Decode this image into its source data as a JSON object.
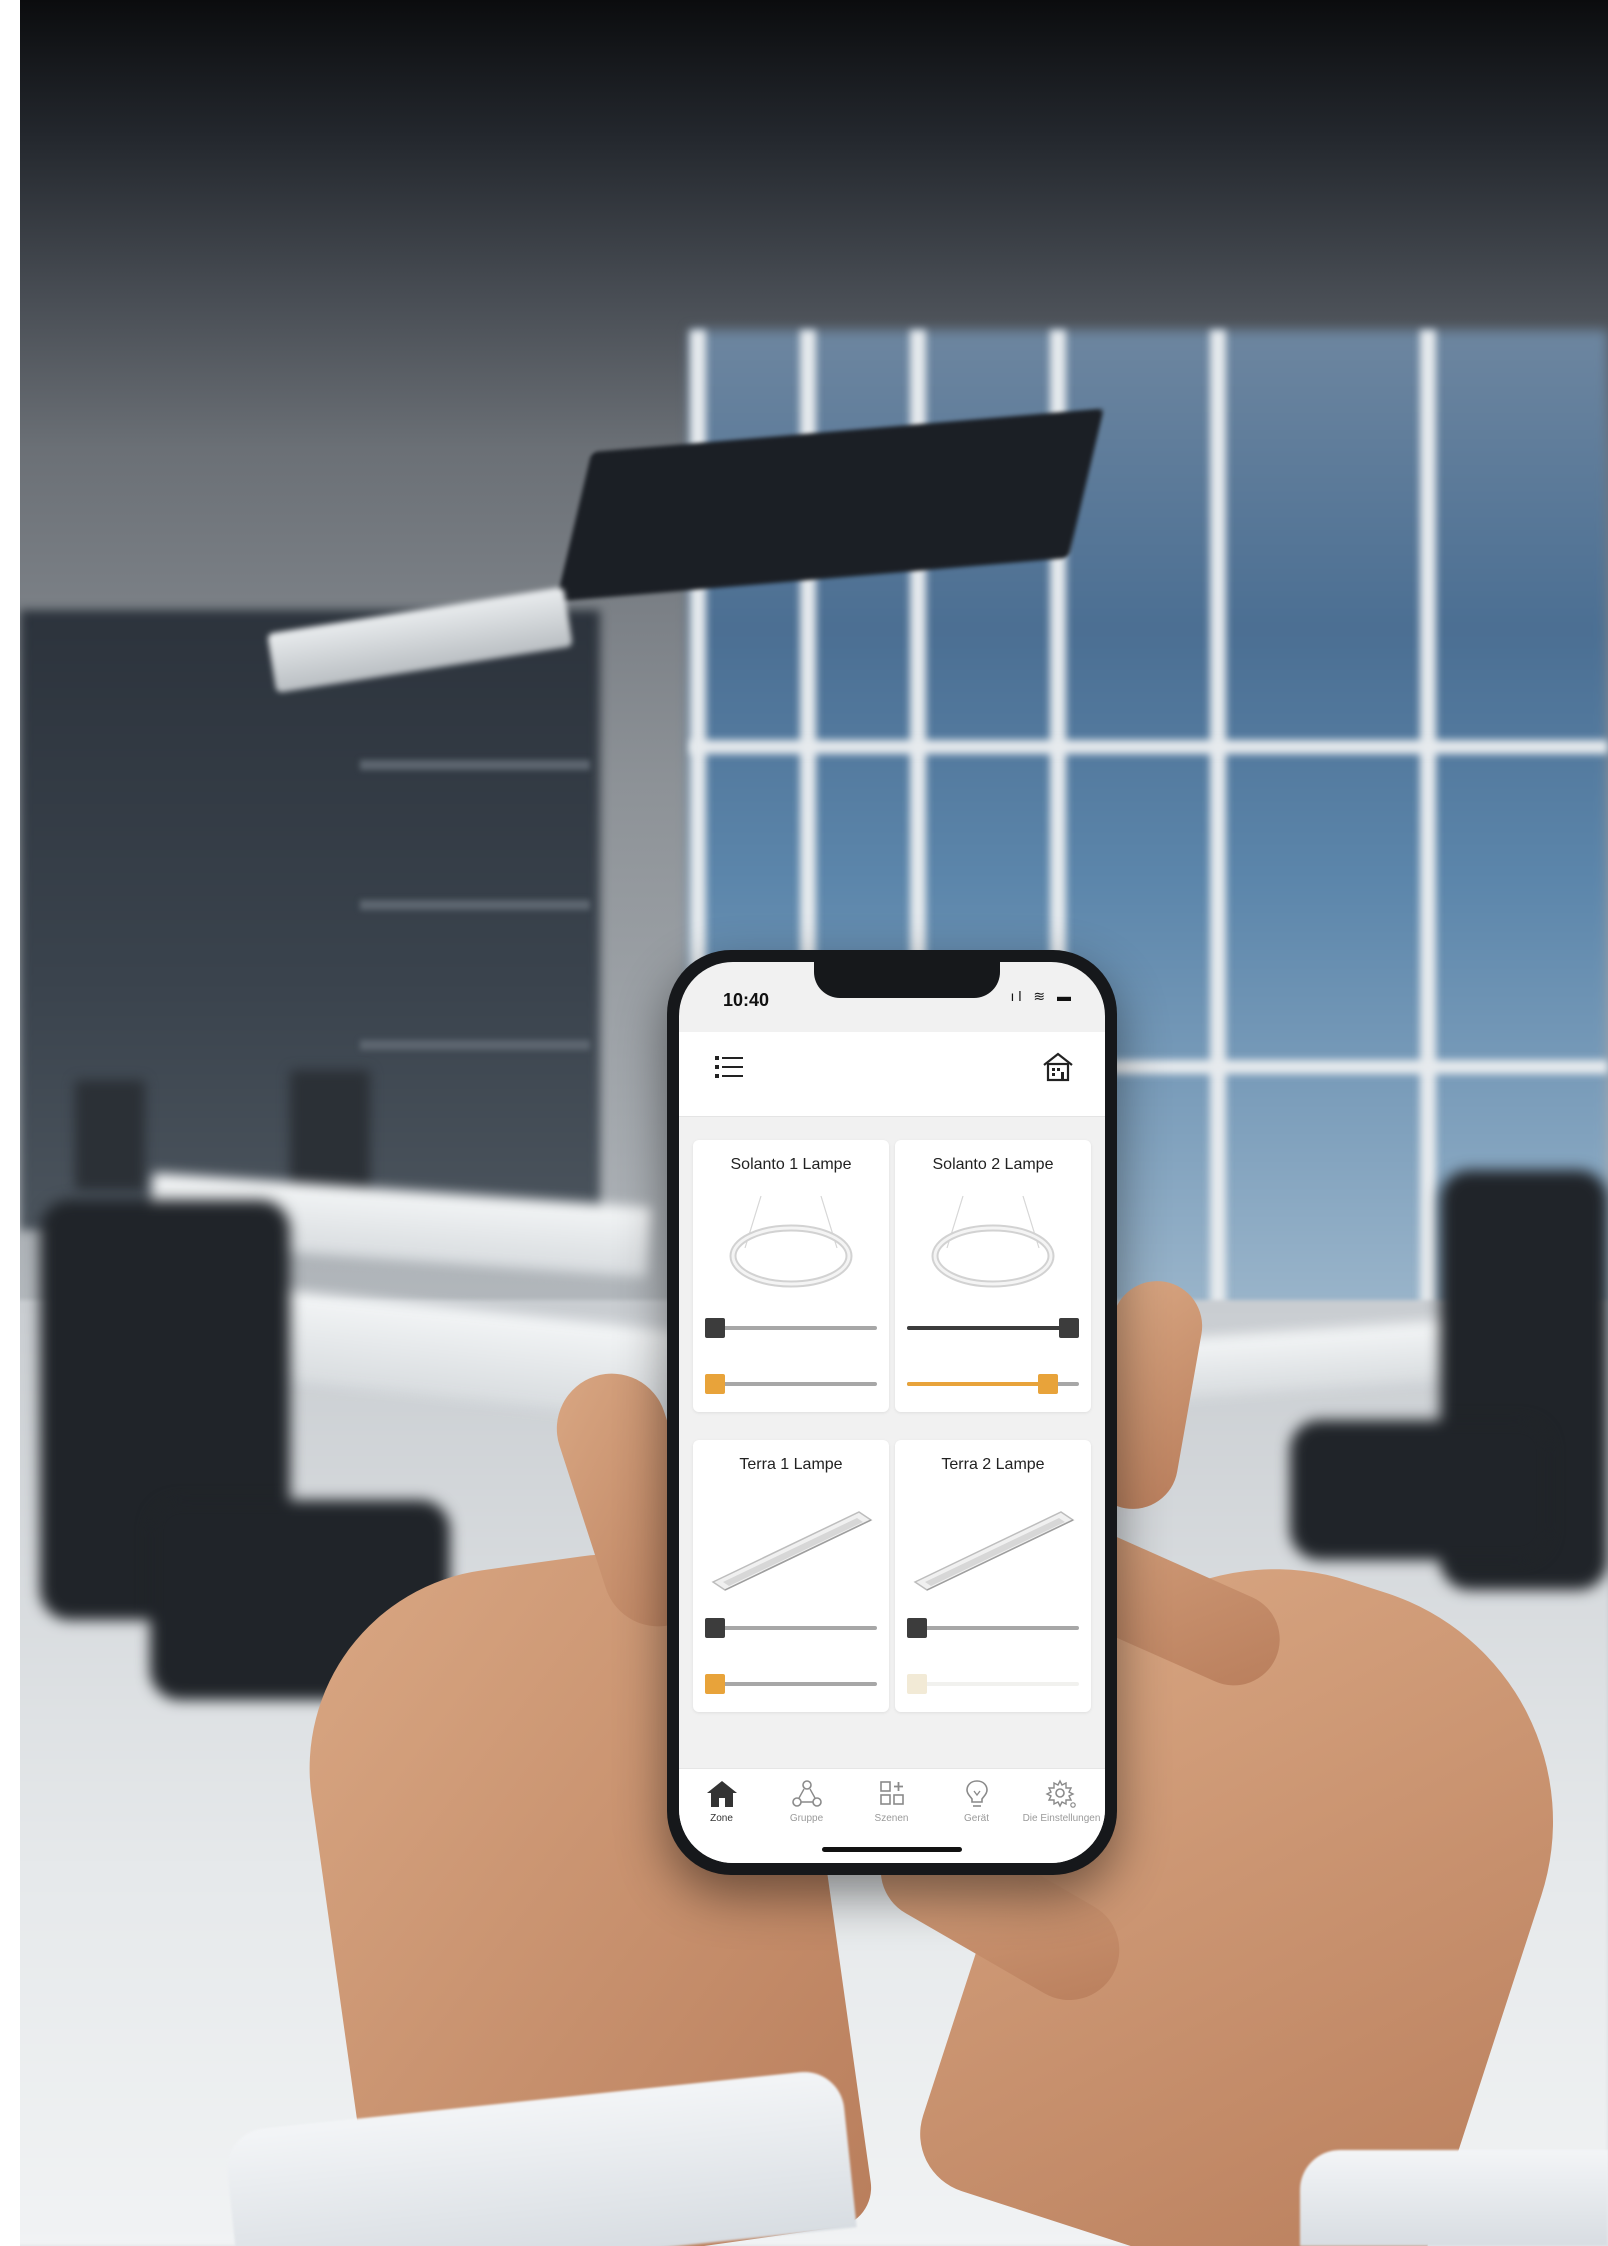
{
  "status_bar": {
    "time": "10:40",
    "icons": "ıl ≋ ▬"
  },
  "header": {
    "menu_icon": "list-menu-icon",
    "home_icon": "building-home-icon"
  },
  "colors": {
    "accent": "#e8a33a",
    "track_inactive": "#a7a7a7",
    "track_active_dark": "#3c3c3c",
    "thumb_dark": "#3c3c3c",
    "accent_pale": "#f2ead6",
    "track_pale": "#f1f1ee"
  },
  "devices": [
    {
      "name": "Solanto 1 Lampe",
      "fixture": "ring-pendant",
      "brightness": 0.0,
      "color_temp": 0.0,
      "temp_state": "active"
    },
    {
      "name": "Solanto 2 Lampe",
      "fixture": "ring-pendant",
      "brightness": 1.0,
      "color_temp": 0.86,
      "temp_state": "active"
    },
    {
      "name": "Terra 1 Lampe",
      "fixture": "linear-panel",
      "brightness": 0.0,
      "color_temp": 0.0,
      "temp_state": "active"
    },
    {
      "name": "Terra 2 Lampe",
      "fixture": "linear-panel",
      "brightness": 0.0,
      "color_temp": 0.0,
      "temp_state": "pale"
    }
  ],
  "tabs": [
    {
      "label": "Zone",
      "icon": "home-icon",
      "active": true
    },
    {
      "label": "Gruppe",
      "icon": "group-nodes-icon",
      "active": false
    },
    {
      "label": "Szenen",
      "icon": "scenes-grid-icon",
      "active": false
    },
    {
      "label": "Gerät",
      "icon": "bulb-icon",
      "active": false
    },
    {
      "label": "Die Einstellungen",
      "icon": "settings-gear-icon",
      "active": false
    }
  ]
}
